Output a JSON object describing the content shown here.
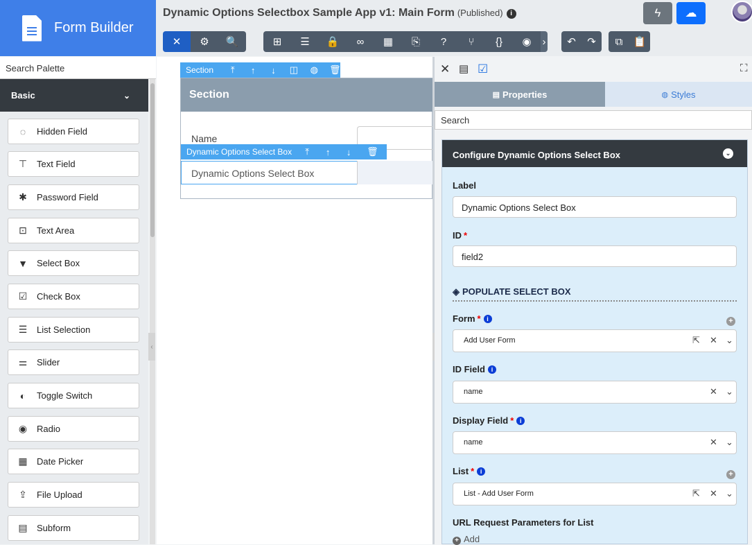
{
  "brand": {
    "title": "Form Builder"
  },
  "header": {
    "app_title": "Dynamic Options Selectbox Sample App v1: Main Form",
    "status": "(Published)"
  },
  "toolbar": {
    "group1": [
      "design-icon",
      "settings-icon",
      "preview-icon"
    ],
    "group2": [
      "tree-icon",
      "form-icon",
      "lock-icon",
      "binoculars-icon",
      "table-icon",
      "translate-icon",
      "help-icon",
      "branch-icon",
      "json-icon",
      "camera-icon"
    ],
    "group3": [
      "undo-icon",
      "redo-icon"
    ],
    "group4": [
      "copy-icon",
      "paste-icon"
    ]
  },
  "palette": {
    "search_placeholder": "Search Palette",
    "category": "Basic",
    "items": [
      {
        "label": "Hidden Field",
        "icon": "eye-slash-icon"
      },
      {
        "label": "Text Field",
        "icon": "text-field-icon"
      },
      {
        "label": "Password Field",
        "icon": "asterisk-icon"
      },
      {
        "label": "Text Area",
        "icon": "text-area-icon"
      },
      {
        "label": "Select Box",
        "icon": "select-box-icon"
      },
      {
        "label": "Check Box",
        "icon": "checkbox-icon"
      },
      {
        "label": "List Selection",
        "icon": "list-icon"
      },
      {
        "label": "Slider",
        "icon": "slider-icon"
      },
      {
        "label": "Toggle Switch",
        "icon": "toggle-icon"
      },
      {
        "label": "Radio",
        "icon": "radio-icon"
      },
      {
        "label": "Date Picker",
        "icon": "calendar-icon"
      },
      {
        "label": "File Upload",
        "icon": "upload-icon"
      },
      {
        "label": "Subform",
        "icon": "subform-icon"
      }
    ]
  },
  "canvas": {
    "section_tag": "Section",
    "section_title": "Section",
    "name_label": "Name",
    "dyn_tag": "Dynamic Options Select Box",
    "dyn_label": "Dynamic Options Select Box"
  },
  "panel": {
    "tabs": {
      "properties": "Properties",
      "styles": "Styles"
    },
    "search_placeholder": "Search",
    "config_title": "Configure Dynamic Options Select Box",
    "label_label": "Label",
    "label_value": "Dynamic Options Select Box",
    "id_label": "ID",
    "id_value": "field2",
    "populate_title": "POPULATE SELECT BOX",
    "form_label": "Form",
    "form_value": "Add User Form",
    "id_field_label": "ID Field",
    "id_field_value": "name",
    "display_field_label": "Display Field",
    "display_field_value": "name",
    "list_label": "List",
    "list_value": "List - Add User Form",
    "url_params_label": "URL Request Parameters for List",
    "add_label": "Add"
  }
}
